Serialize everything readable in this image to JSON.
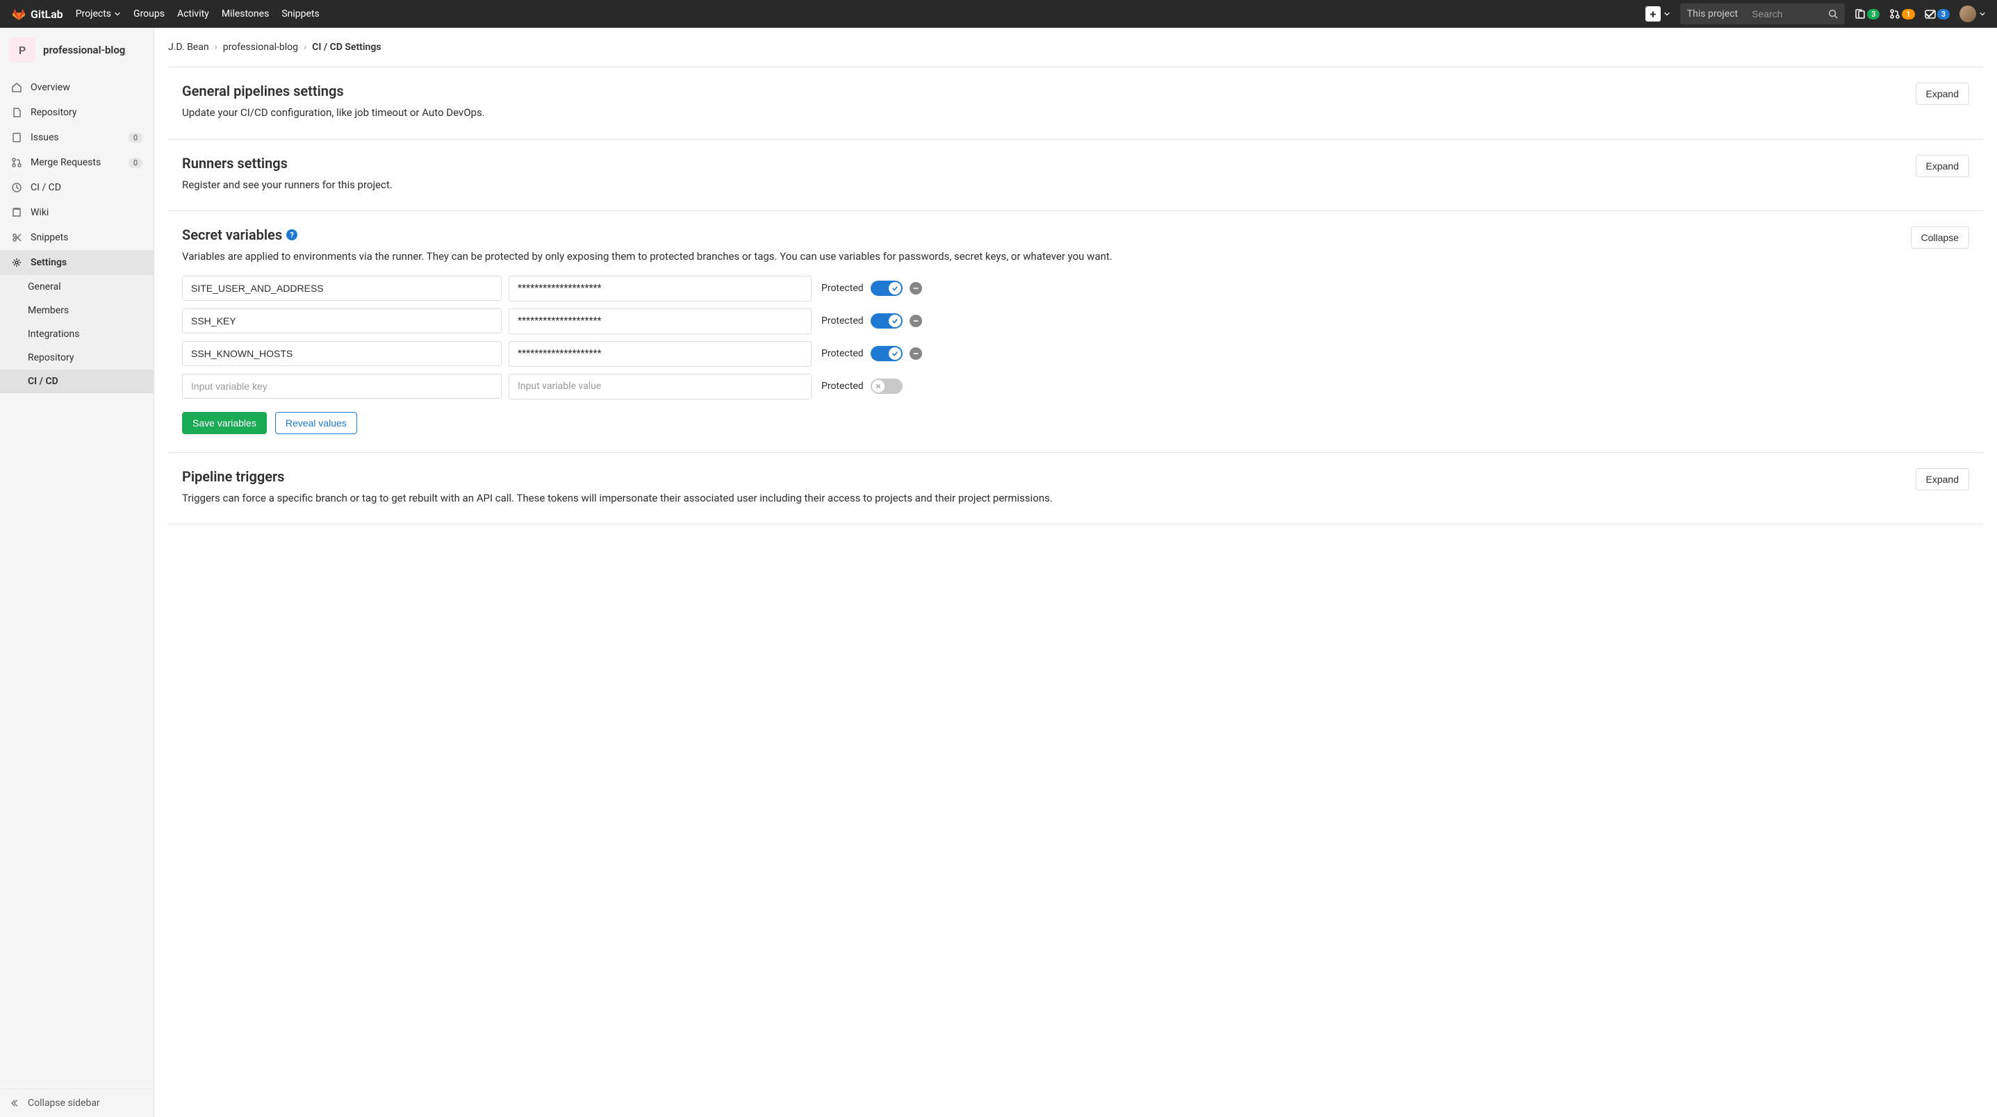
{
  "navbar": {
    "brand": "GitLab",
    "items": [
      "Projects",
      "Groups",
      "Activity",
      "Milestones",
      "Snippets"
    ],
    "search_scope": "This project",
    "search_placeholder": "Search",
    "badges": {
      "issues": "3",
      "mr": "1",
      "todos": "3"
    }
  },
  "sidebar": {
    "project_letter": "P",
    "project_name": "professional-blog",
    "items": [
      {
        "label": "Overview"
      },
      {
        "label": "Repository"
      },
      {
        "label": "Issues",
        "count": "0"
      },
      {
        "label": "Merge Requests",
        "count": "0"
      },
      {
        "label": "CI / CD"
      },
      {
        "label": "Wiki"
      },
      {
        "label": "Snippets"
      },
      {
        "label": "Settings"
      }
    ],
    "settings_sub": [
      "General",
      "Members",
      "Integrations",
      "Repository",
      "CI / CD"
    ],
    "collapse": "Collapse sidebar"
  },
  "breadcrumb": {
    "a": "J.D. Bean",
    "b": "professional-blog",
    "c": "CI / CD Settings"
  },
  "sections": {
    "general": {
      "title": "General pipelines settings",
      "desc": "Update your CI/CD configuration, like job timeout or Auto DevOps.",
      "btn": "Expand"
    },
    "runners": {
      "title": "Runners settings",
      "desc": "Register and see your runners for this project.",
      "btn": "Expand"
    },
    "secret": {
      "title": "Secret variables",
      "desc": "Variables are applied to environments via the runner. They can be protected by only exposing them to protected branches or tags. You can use variables for passwords, secret keys, or whatever you want.",
      "btn": "Collapse",
      "protected_label": "Protected",
      "key_placeholder": "Input variable key",
      "value_placeholder": "Input variable value",
      "save": "Save variables",
      "reveal": "Reveal values",
      "rows": [
        {
          "key": "SITE_USER_AND_ADDRESS",
          "value": "********************"
        },
        {
          "key": "SSH_KEY",
          "value": "********************"
        },
        {
          "key": "SSH_KNOWN_HOSTS",
          "value": "********************"
        }
      ]
    },
    "triggers": {
      "title": "Pipeline triggers",
      "desc": "Triggers can force a specific branch or tag to get rebuilt with an API call. These tokens will impersonate their associated user including their access to projects and their project permissions.",
      "btn": "Expand"
    }
  }
}
